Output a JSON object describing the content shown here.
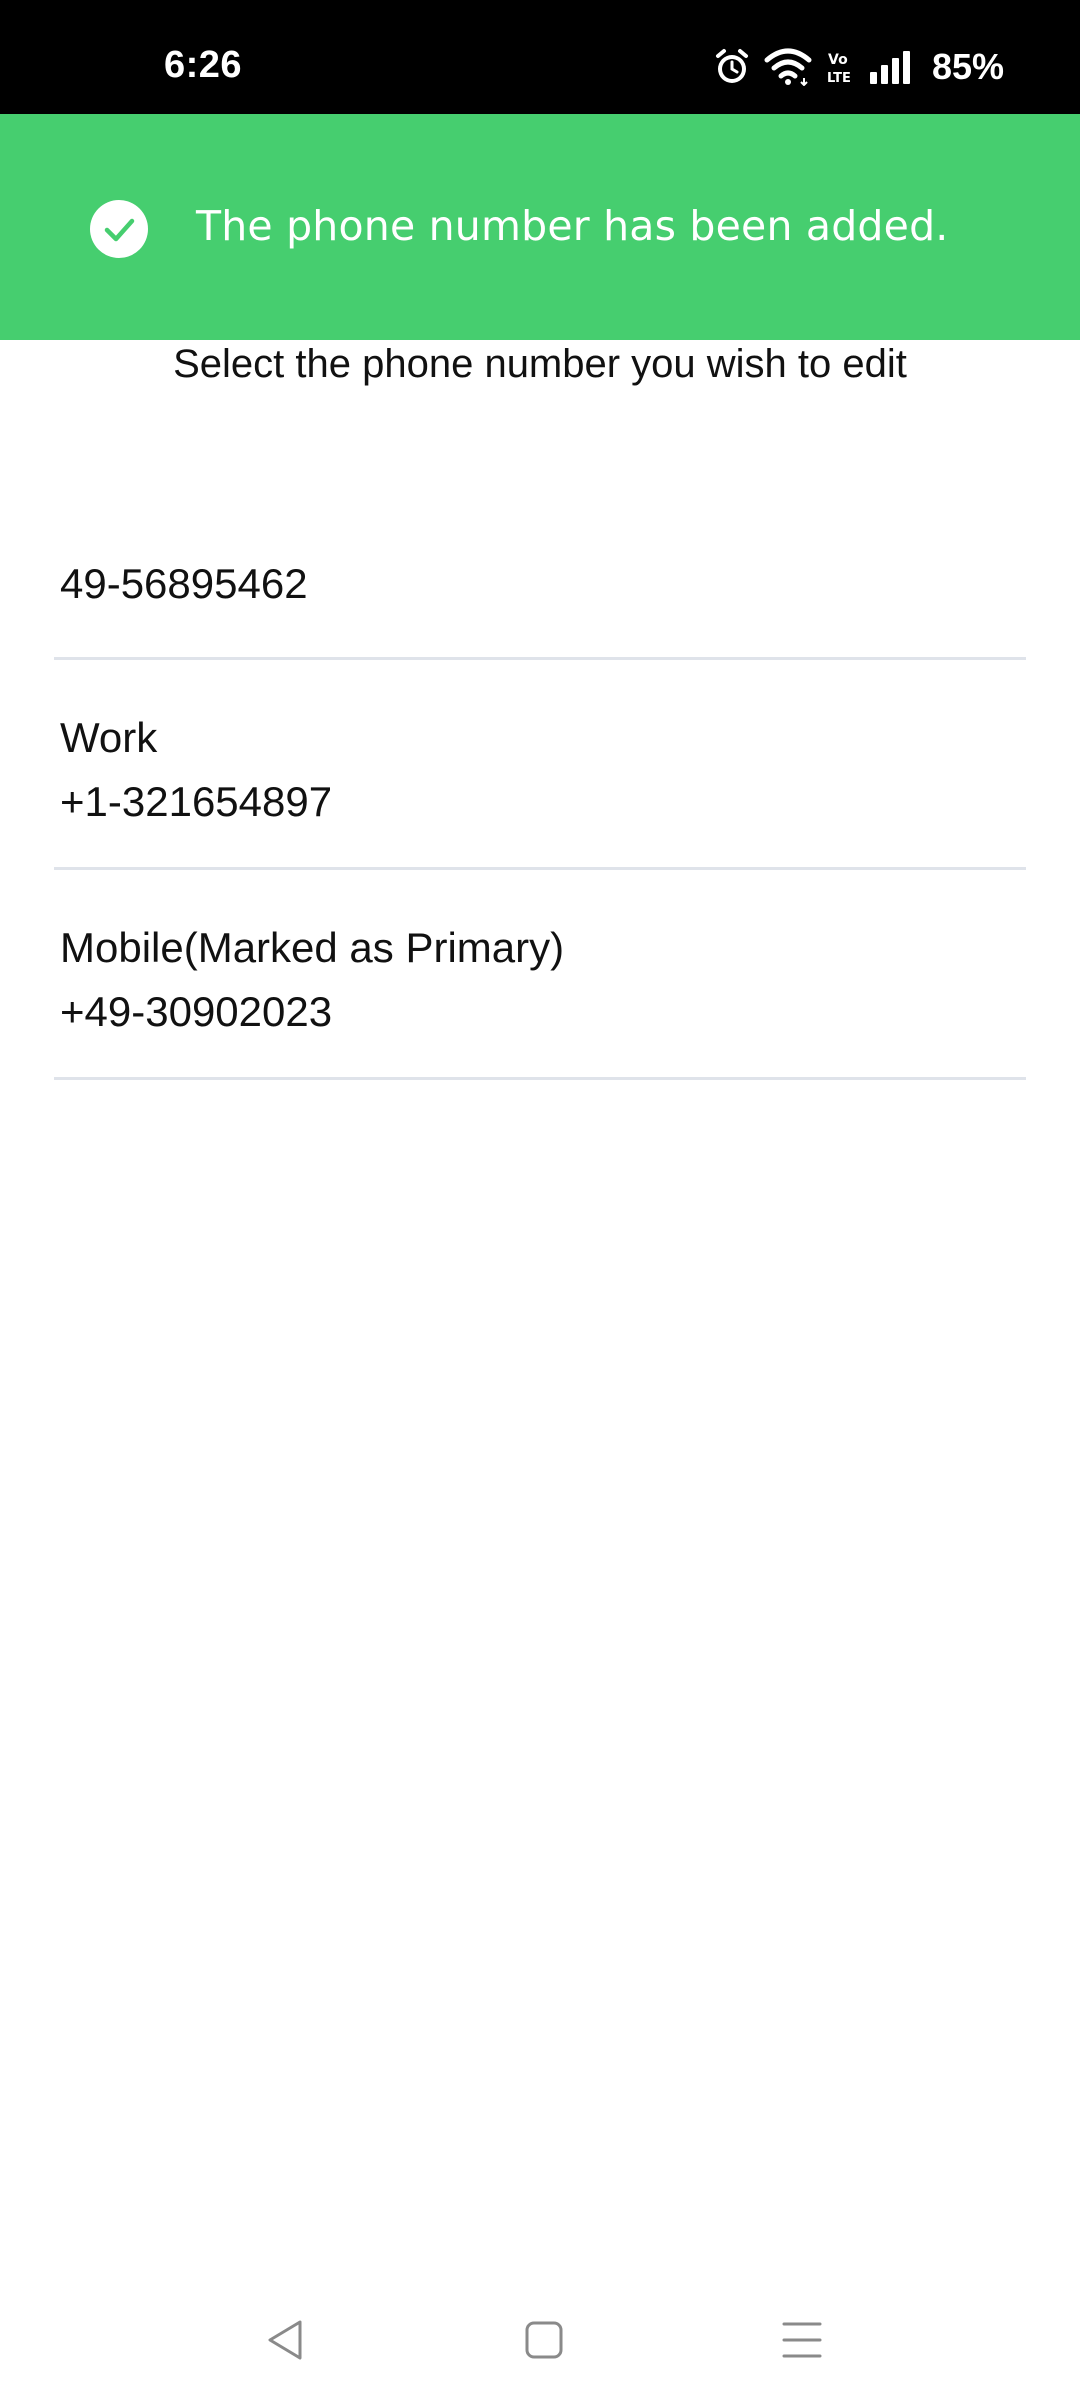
{
  "status_bar": {
    "time": "6:26",
    "battery": "85%",
    "volte": "Vo LTE",
    "icons": [
      "alarm-icon",
      "wifi-icon",
      "volte-icon",
      "signal-icon"
    ]
  },
  "toast": {
    "message": "The phone number has been added.",
    "icon": "check-circle-icon",
    "color": "#46ce6f"
  },
  "instruction": "Select the phone number you wish to edit",
  "phones": [
    {
      "label": "",
      "number": "49-56895462"
    },
    {
      "label": "Work",
      "number": "+1-321654897"
    },
    {
      "label": "Mobile(Marked as Primary)",
      "number": "+49-30902023"
    }
  ],
  "nav_bar": {
    "icons": [
      "back-icon",
      "home-icon",
      "menu-icon"
    ]
  }
}
